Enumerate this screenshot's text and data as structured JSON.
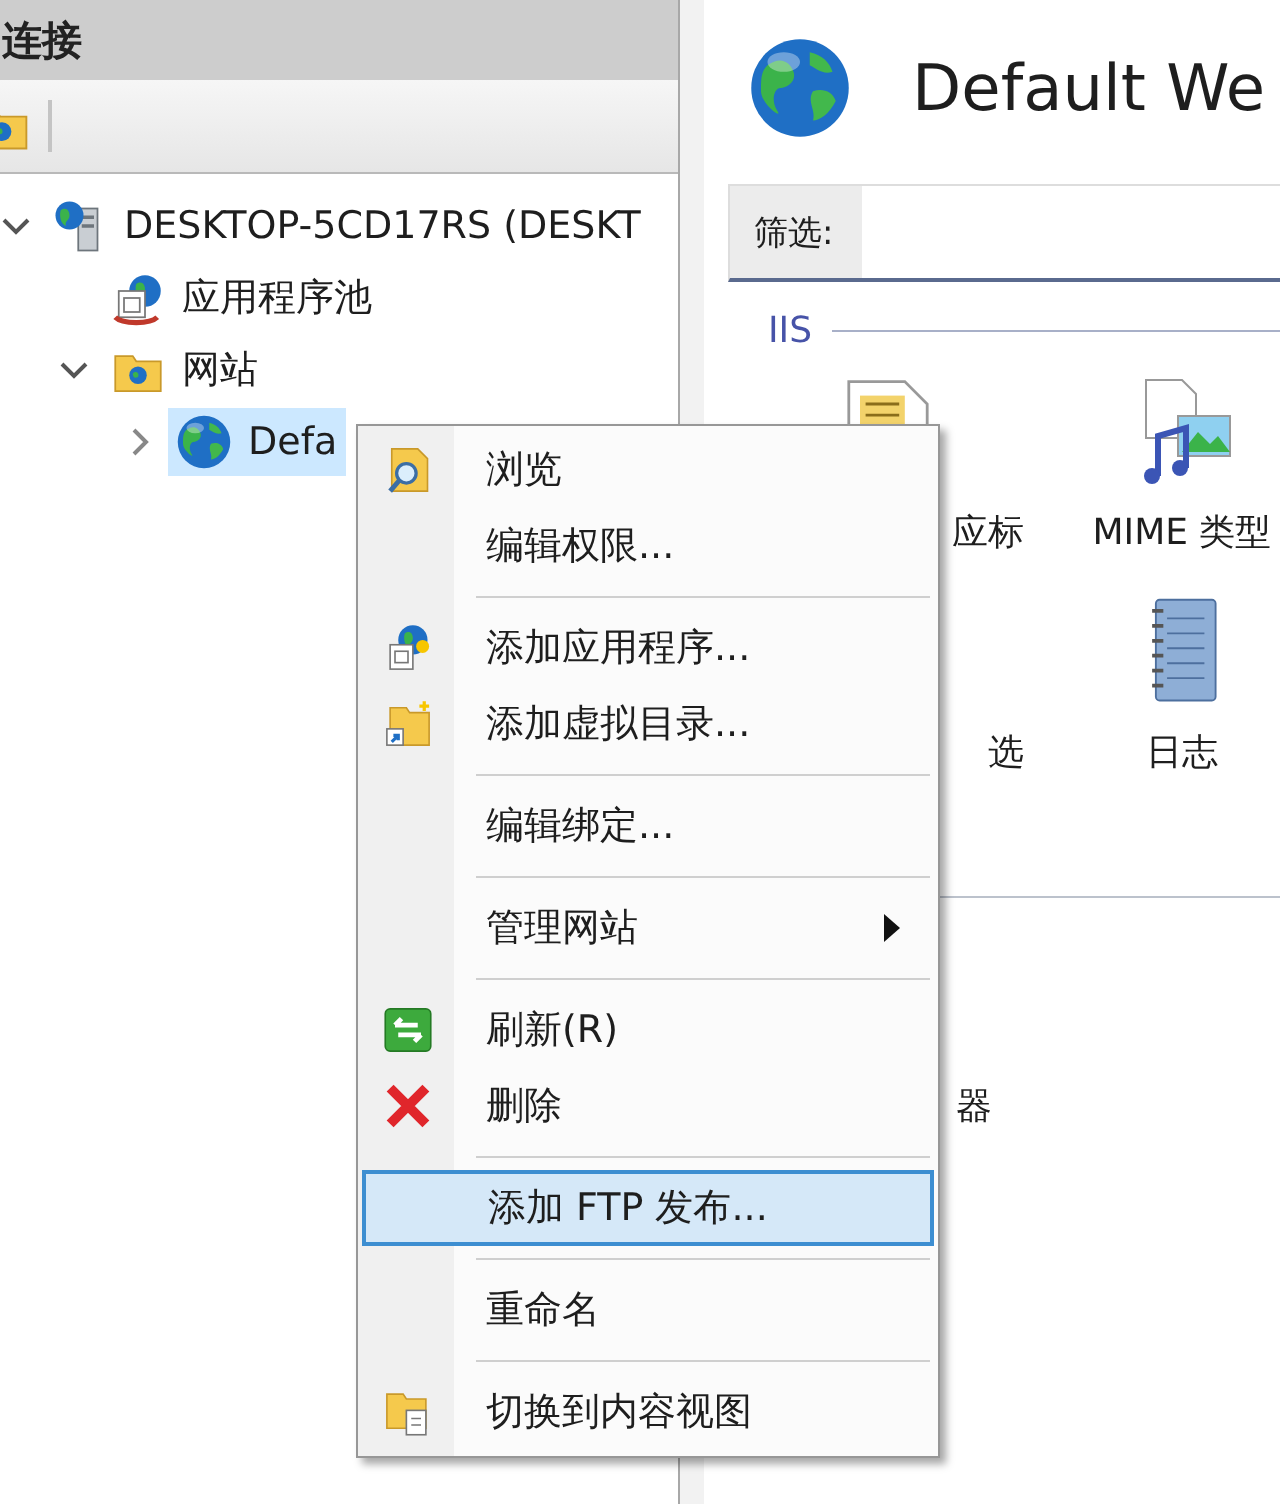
{
  "connections": {
    "title": "连接",
    "tree": [
      {
        "label": "DESKTOP-5CD17RS (DESKT",
        "expanded": true,
        "selected": false,
        "children": [
          {
            "label": "应用程序池",
            "selected": false
          },
          {
            "label": "网站",
            "expanded": true,
            "selected": false,
            "children": [
              {
                "label": "Defa",
                "expanded": false,
                "selected": true
              }
            ]
          }
        ]
      }
    ]
  },
  "feature_view": {
    "title": "Default We",
    "filter": {
      "label": "筛选:"
    },
    "group": "IIS",
    "features": [
      {
        "label": "应标"
      },
      {
        "label": "MIME 类型"
      },
      {
        "label": "选"
      },
      {
        "label": "日志"
      }
    ],
    "lower_features": [
      {
        "label": "器"
      }
    ]
  },
  "context_menu": [
    {
      "kind": "item",
      "label": "浏览",
      "selected": false
    },
    {
      "kind": "item",
      "label": "编辑权限...",
      "selected": false
    },
    {
      "kind": "separator"
    },
    {
      "kind": "item",
      "label": "添加应用程序...",
      "selected": false
    },
    {
      "kind": "item",
      "label": "添加虚拟目录...",
      "selected": false
    },
    {
      "kind": "separator"
    },
    {
      "kind": "item",
      "label": "编辑绑定...",
      "selected": false
    },
    {
      "kind": "separator"
    },
    {
      "kind": "submenu",
      "label": "管理网站",
      "selected": false
    },
    {
      "kind": "separator"
    },
    {
      "kind": "item",
      "label": "刷新(R)",
      "selected": false
    },
    {
      "kind": "item",
      "label": "删除",
      "selected": false
    },
    {
      "kind": "separator"
    },
    {
      "kind": "item",
      "label": "添加 FTP 发布...",
      "selected": true
    },
    {
      "kind": "separator"
    },
    {
      "kind": "item",
      "label": "重命名",
      "selected": false
    },
    {
      "kind": "separator"
    },
    {
      "kind": "item",
      "label": "切换到内容视图",
      "selected": false
    }
  ]
}
